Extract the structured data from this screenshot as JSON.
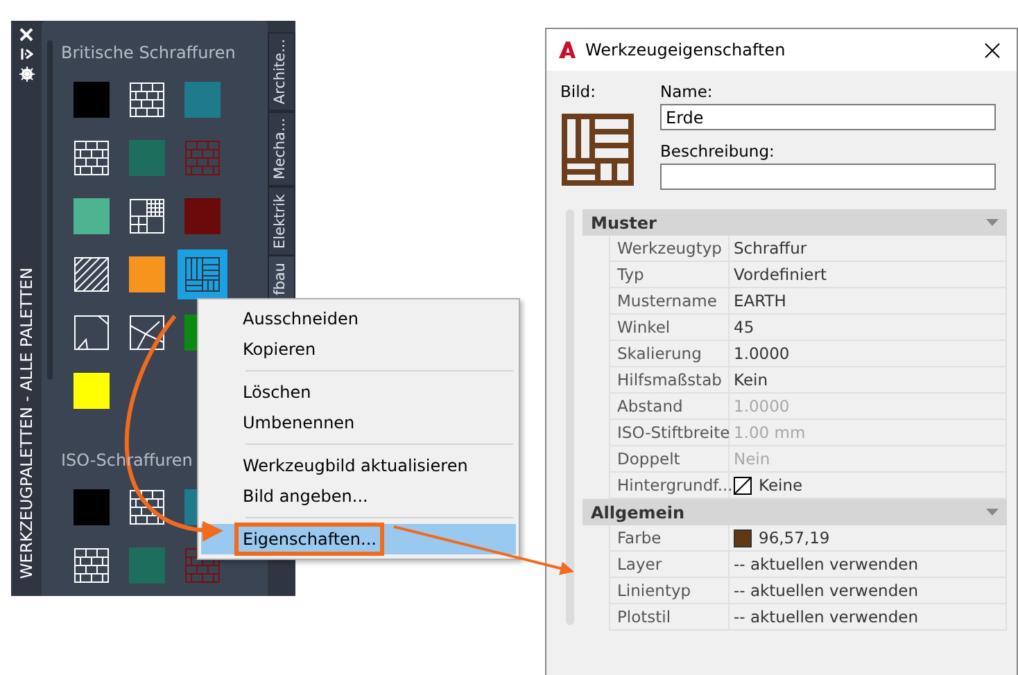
{
  "palette": {
    "title": "WERKZEUGPALETTEN - ALLE PALETTEN",
    "side_tabs": [
      {
        "label": "Archite...",
        "selected": false
      },
      {
        "label": "Mecha...",
        "selected": false
      },
      {
        "label": "Elektrik",
        "selected": false
      },
      {
        "label": "fbau",
        "selected": true
      }
    ],
    "sections": [
      {
        "title": "Britische Schraffuren",
        "tiles": [
          {
            "kind": "solid",
            "color": "#000000",
            "selected": false
          },
          {
            "kind": "brick",
            "color": "#ffffff",
            "selected": false
          },
          {
            "kind": "solid",
            "color": "#1f7a8c",
            "selected": false
          },
          {
            "kind": "brick",
            "color": "#ffffff",
            "selected": false
          },
          {
            "kind": "solid",
            "color": "#1e6e5e",
            "selected": false
          },
          {
            "kind": "brick",
            "color": "#7a1010",
            "selected": false
          },
          {
            "kind": "solid",
            "color": "#4db391",
            "selected": false
          },
          {
            "kind": "grid",
            "color": "#ffffff",
            "selected": false
          },
          {
            "kind": "solid",
            "color": "#6b0a0a",
            "selected": false
          },
          {
            "kind": "diagonal",
            "color": "#ffffff",
            "selected": false
          },
          {
            "kind": "solid",
            "color": "#f7941d",
            "selected": false
          },
          {
            "kind": "earth",
            "color": "#1ba1e2",
            "selected": true
          },
          {
            "kind": "corner",
            "color": "#ffffff",
            "selected": false
          },
          {
            "kind": "triangles",
            "color": "#ffffff",
            "selected": false
          },
          {
            "kind": "solid",
            "color": "#0a8a10",
            "selected": false
          },
          {
            "kind": "solid",
            "color": "#ffff00",
            "selected": false
          }
        ]
      },
      {
        "title": "ISO-Schraffuren",
        "tiles": [
          {
            "kind": "solid",
            "color": "#000000",
            "selected": false
          },
          {
            "kind": "brick",
            "color": "#ffffff",
            "selected": false
          },
          {
            "kind": "solid",
            "color": "#1f7a8c",
            "selected": false
          },
          {
            "kind": "brick",
            "color": "#ffffff",
            "selected": false
          },
          {
            "kind": "solid",
            "color": "#1e6e5e",
            "selected": false
          },
          {
            "kind": "brick",
            "color": "#7a1010",
            "selected": false
          }
        ]
      }
    ]
  },
  "context_menu": {
    "groups": [
      [
        {
          "label": "Ausschneiden",
          "selected": false
        },
        {
          "label": "Kopieren",
          "selected": false
        }
      ],
      [
        {
          "label": "Löschen",
          "selected": false
        },
        {
          "label": "Umbenennen",
          "selected": false
        }
      ],
      [
        {
          "label": "Werkzeugbild aktualisieren",
          "selected": false
        },
        {
          "label": "Bild angeben...",
          "selected": false
        }
      ],
      [
        {
          "label": "Eigenschaften...",
          "selected": true
        }
      ]
    ]
  },
  "dialog": {
    "title": "Werkzeugeigenschaften",
    "image_label": "Bild:",
    "name_label": "Name:",
    "name_value": "Erde",
    "description_label": "Beschreibung:",
    "sections": [
      {
        "title": "Muster",
        "expanded": true,
        "rows": [
          {
            "kind": "text",
            "label": "Werkzeugtyp",
            "value": "Schraffur",
            "disabled": false
          },
          {
            "kind": "text",
            "label": "Typ",
            "value": "Vordefiniert",
            "disabled": false
          },
          {
            "kind": "text",
            "label": "Mustername",
            "value": "EARTH",
            "disabled": false
          },
          {
            "kind": "text",
            "label": "Winkel",
            "value": "45",
            "disabled": false
          },
          {
            "kind": "text",
            "label": "Skalierung",
            "value": "1.0000",
            "disabled": false
          },
          {
            "kind": "text",
            "label": "Hilfsmaßstab",
            "value": "Kein",
            "disabled": false
          },
          {
            "kind": "text",
            "label": "Abstand",
            "value": "1.0000",
            "disabled": true
          },
          {
            "kind": "text",
            "label": "ISO-Stiftbreite",
            "value": "1.00 mm",
            "disabled": true
          },
          {
            "kind": "text",
            "label": "Doppelt",
            "value": "Nein",
            "disabled": true
          },
          {
            "kind": "nofill",
            "label": "Hintergrundf...",
            "value": "Keine",
            "disabled": false
          }
        ]
      },
      {
        "title": "Allgemein",
        "expanded": true,
        "rows": [
          {
            "kind": "color",
            "label": "Farbe",
            "value": "96,57,19",
            "color": "#603913",
            "disabled": false
          },
          {
            "kind": "text",
            "label": "Layer",
            "value": "-- aktuellen verwenden",
            "disabled": false
          },
          {
            "kind": "text",
            "label": "Linientyp",
            "value": "-- aktuellen verwenden",
            "disabled": false
          },
          {
            "kind": "text",
            "label": "Plotstil",
            "value": "-- aktuellen verwenden",
            "disabled": false
          }
        ]
      }
    ]
  }
}
